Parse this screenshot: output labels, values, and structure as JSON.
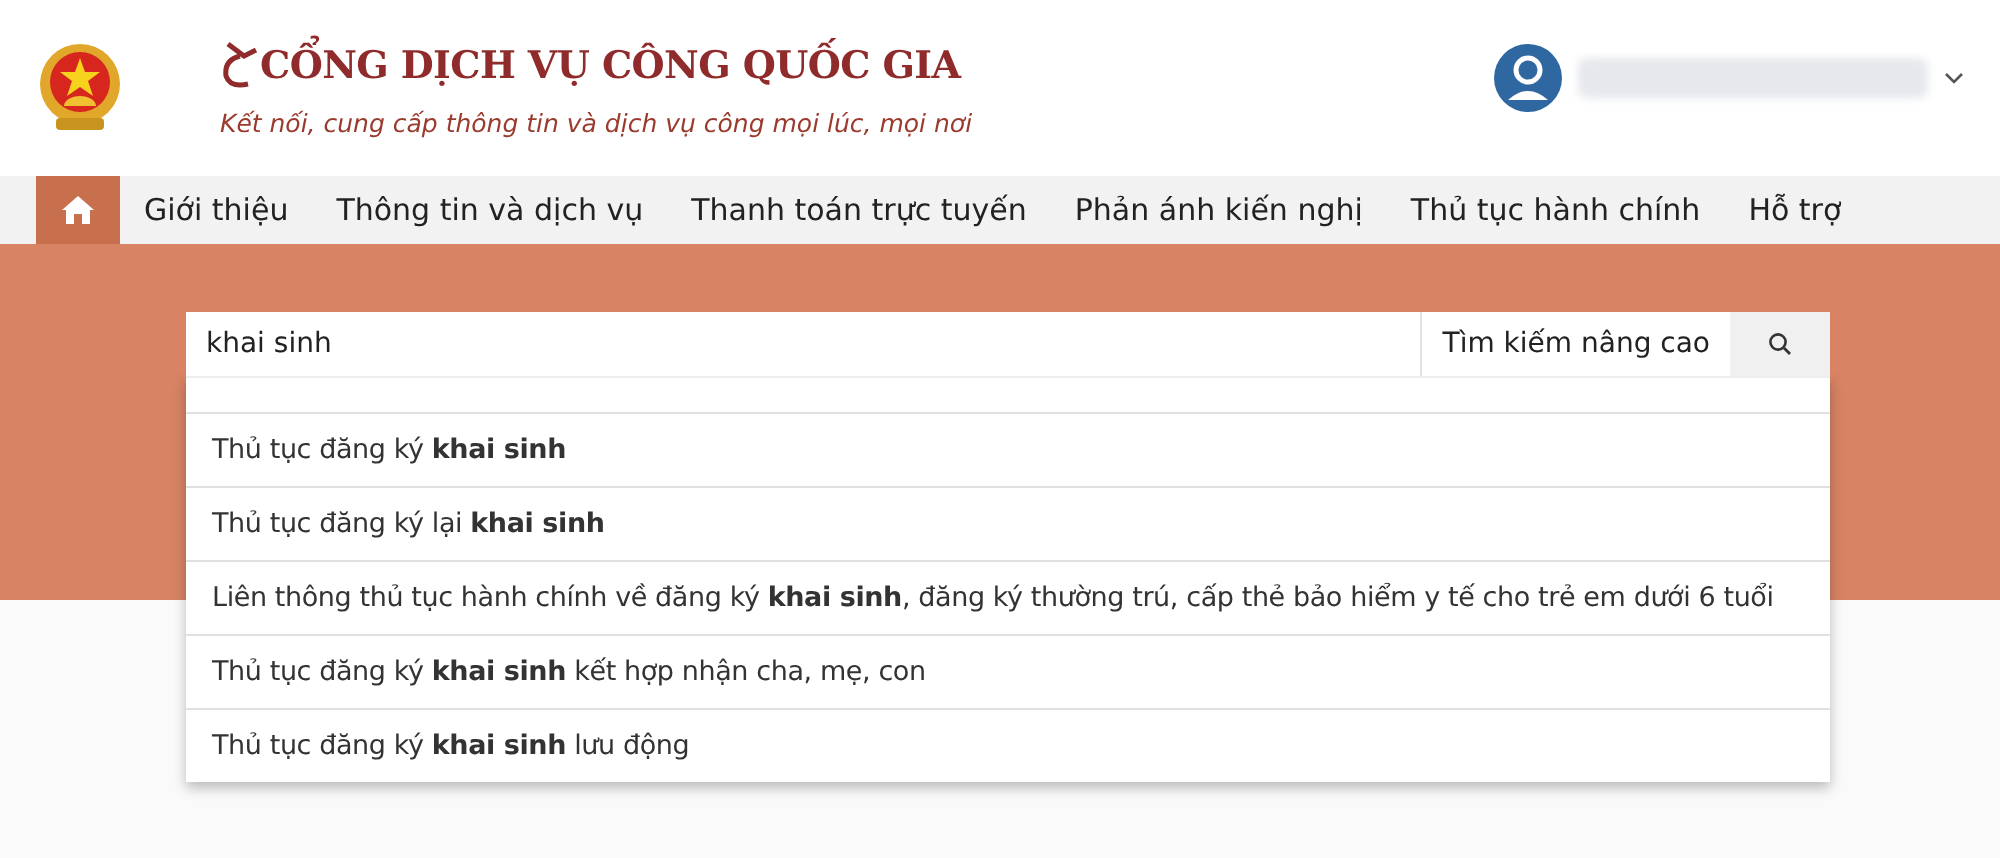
{
  "header": {
    "title": "CỔNG DỊCH VỤ CÔNG QUỐC GIA",
    "slogan": "Kết nối, cung cấp thông tin và dịch vụ công mọi lúc, mọi nơi"
  },
  "nav": [
    {
      "kind": "home",
      "selected": true
    },
    {
      "kind": "text",
      "label": "Giới thiệu",
      "selected": false
    },
    {
      "kind": "text",
      "label": "Thông tin và dịch vụ",
      "selected": false
    },
    {
      "kind": "text",
      "label": "Thanh toán trực tuyến",
      "selected": false
    },
    {
      "kind": "text",
      "label": "Phản ánh kiến nghị",
      "selected": false
    },
    {
      "kind": "text",
      "label": "Thủ tục hành chính",
      "selected": false
    },
    {
      "kind": "text",
      "label": "Hỗ trợ",
      "selected": false
    }
  ],
  "search": {
    "value": "khai sinh",
    "advanced": "Tìm kiếm nâng cao"
  },
  "suggestions": [
    "Thủ tục đăng ký **khai sinh**",
    "Thủ tục đăng ký lại **khai sinh**",
    "Liên thông thủ tục hành chính về đăng ký **khai sinh**, đăng ký thường trú, cấp thẻ bảo hiểm y tế cho trẻ em dưới 6 tuổi",
    "Thủ tục đăng ký **khai sinh** kết hợp nhận cha, mẹ, con",
    "Thủ tục đăng ký **khai sinh** lưu động"
  ]
}
